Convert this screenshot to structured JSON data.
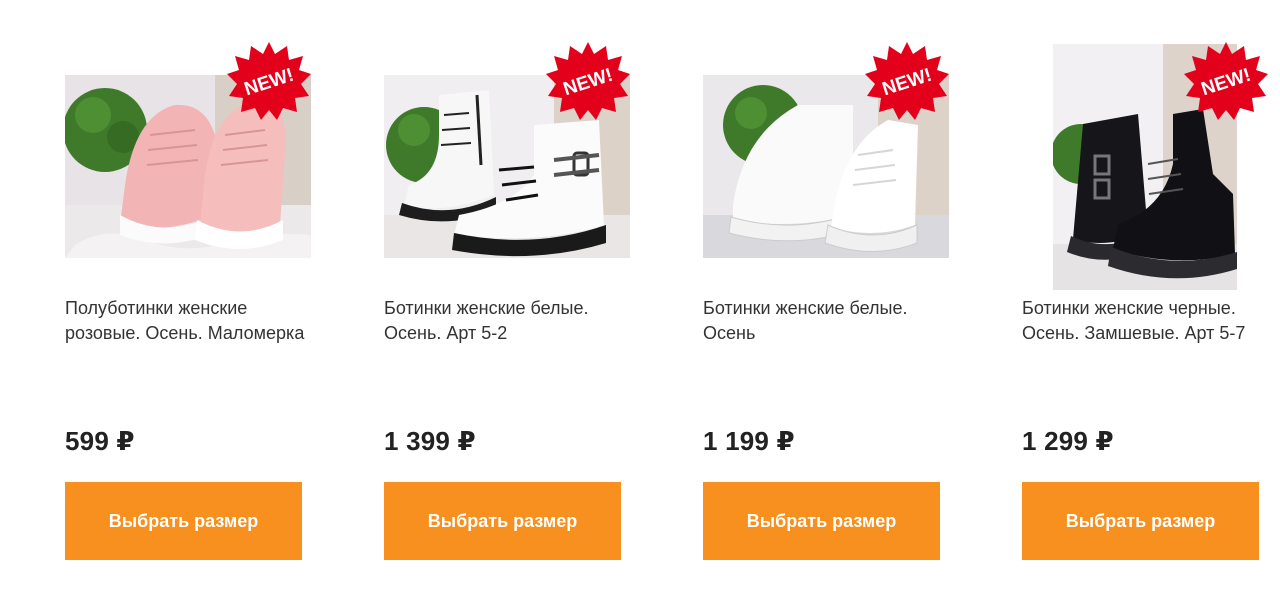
{
  "colors": {
    "button_bg": "#f7901e",
    "button_text": "#ffffff",
    "badge_red": "#e3001b",
    "title_text": "#333333",
    "price_text": "#222222"
  },
  "badge_label": "NEW!",
  "products": [
    {
      "title": "Полуботинки женские розовые. Осень. Маломерка",
      "price": "599 ₽",
      "button_label": "Выбрать размер",
      "image_icon": "pink-sneakers-photo"
    },
    {
      "title": "Ботинки женские белые. Осень. Арт 5-2",
      "price": "1 399 ₽",
      "button_label": "Выбрать размер",
      "image_icon": "white-boots-photo"
    },
    {
      "title": "Ботинки женские белые. Осень",
      "price": "1 199 ₽",
      "button_label": "Выбрать размер",
      "image_icon": "white-high-sneakers-photo"
    },
    {
      "title": "Ботинки женские черные. Осень. Замшевые. Арт 5-7",
      "price": "1 299 ₽",
      "button_label": "Выбрать размер",
      "image_icon": "black-suede-boots-photo"
    }
  ]
}
